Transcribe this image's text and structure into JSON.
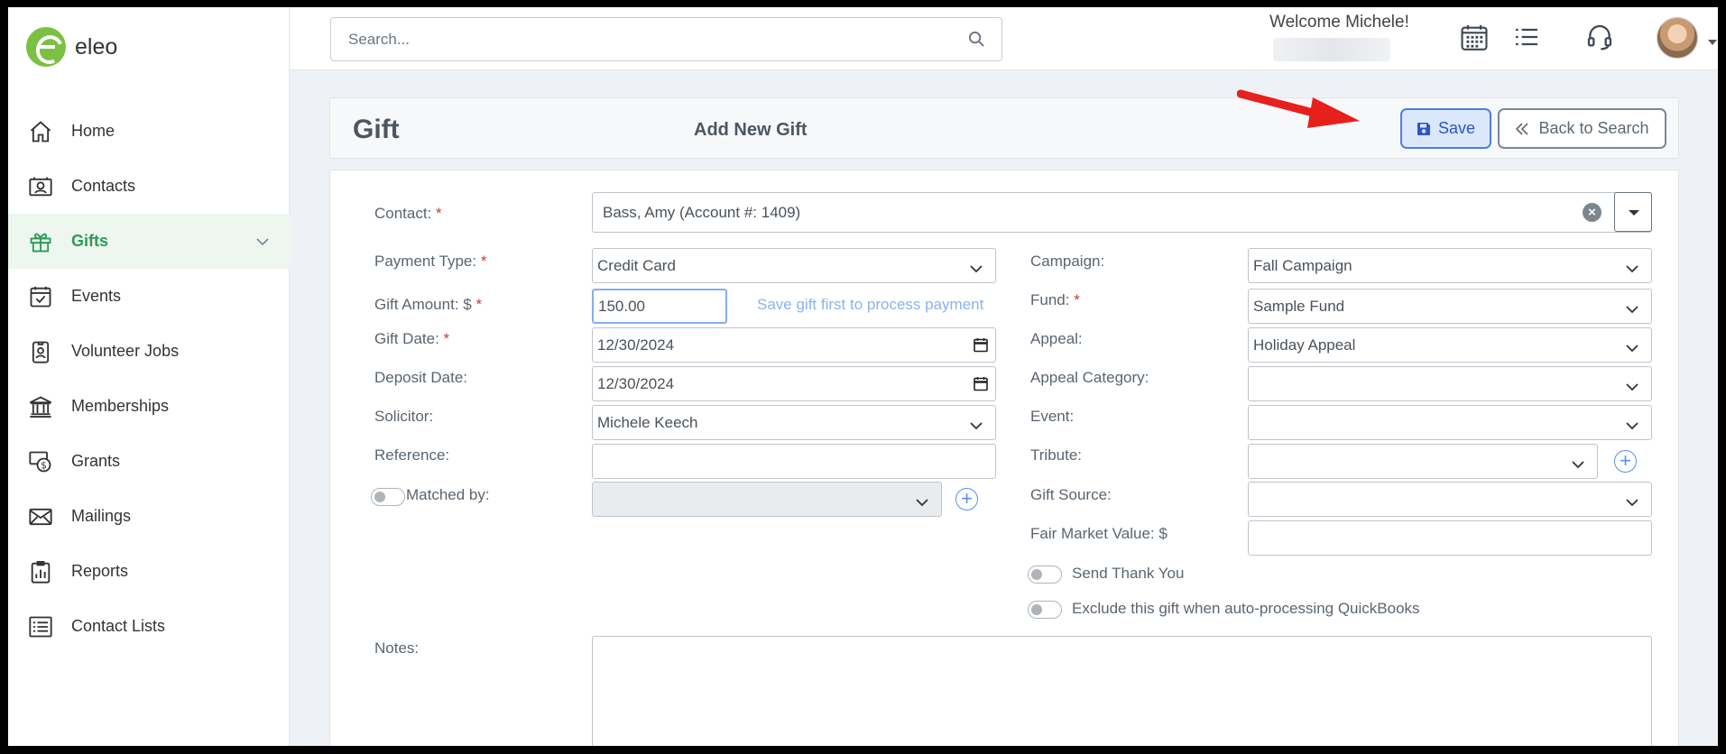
{
  "app": {
    "logo_text": "eleo",
    "brand_color": "#7ac143",
    "accent_color": "#2e9a57"
  },
  "sidebar": {
    "items": [
      {
        "label": "Home",
        "icon": "home-icon"
      },
      {
        "label": "Contacts",
        "icon": "contacts-icon"
      },
      {
        "label": "Gifts",
        "icon": "gift-icon",
        "active": true
      },
      {
        "label": "Events",
        "icon": "calendar-check-icon"
      },
      {
        "label": "Volunteer Jobs",
        "icon": "badge-icon"
      },
      {
        "label": "Memberships",
        "icon": "bank-icon"
      },
      {
        "label": "Grants",
        "icon": "money-icon"
      },
      {
        "label": "Mailings",
        "icon": "envelope-icon"
      },
      {
        "label": "Reports",
        "icon": "report-icon"
      },
      {
        "label": "Contact Lists",
        "icon": "list-icon"
      }
    ]
  },
  "topbar": {
    "search_placeholder": "Search...",
    "welcome": "Welcome Michele!",
    "icons": [
      "calendar-grid-icon",
      "list-icon",
      "headset-icon"
    ]
  },
  "header": {
    "title": "Gift",
    "subtitle": "Add New Gift",
    "save_label": "Save",
    "back_label": "Back to Search"
  },
  "form": {
    "contact": {
      "label": "Contact:",
      "value": "Bass, Amy (Account #: 1409)"
    },
    "payment_type": {
      "label": "Payment Type:",
      "value": "Credit Card"
    },
    "gift_amount": {
      "label": "Gift Amount: $",
      "value": "150.00",
      "hint": "Save gift first to process payment"
    },
    "gift_date": {
      "label": "Gift Date:",
      "value": "12/30/2024"
    },
    "deposit_date": {
      "label": "Deposit Date:",
      "value": "12/30/2024"
    },
    "solicitor": {
      "label": "Solicitor:",
      "value": "Michele Keech"
    },
    "reference": {
      "label": "Reference:",
      "value": ""
    },
    "matched_by": {
      "label": "Matched by:",
      "value": ""
    },
    "campaign": {
      "label": "Campaign:",
      "value": "Fall Campaign"
    },
    "fund": {
      "label": "Fund:",
      "value": "Sample Fund"
    },
    "appeal": {
      "label": "Appeal:",
      "value": "Holiday Appeal"
    },
    "appeal_category": {
      "label": "Appeal Category:",
      "value": ""
    },
    "event": {
      "label": "Event:",
      "value": ""
    },
    "tribute": {
      "label": "Tribute:",
      "value": ""
    },
    "gift_source": {
      "label": "Gift Source:",
      "value": ""
    },
    "fair_market_value": {
      "label": "Fair Market Value: $",
      "value": ""
    },
    "send_thank_you": {
      "label": "Send Thank You",
      "checked": false
    },
    "exclude_qb": {
      "label": "Exclude this gift when auto-processing QuickBooks",
      "checked": false
    },
    "notes": {
      "label": "Notes:",
      "value": ""
    },
    "required_mark": "*"
  }
}
